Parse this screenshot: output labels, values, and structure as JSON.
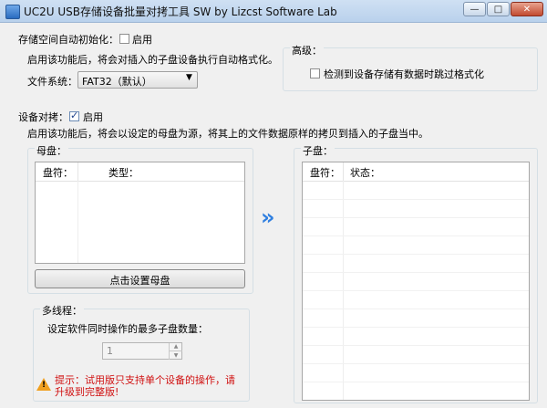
{
  "window": {
    "title": "UC2U USB存储设备批量对拷工具 SW  by Lizcst Software Lab",
    "min_label": "—",
    "max_label": "□",
    "close_label": "✕"
  },
  "autoformat": {
    "label": "存储空间自动初始化：",
    "enable_label": "启用",
    "enabled": false,
    "desc": "启用该功能后，将会对插入的子盘设备执行自动格式化。",
    "fs_label": "文件系统：",
    "fs_value": "FAT32（默认）",
    "advanced_title": "高级：",
    "skip_label": "检测到设备存储有数据时跳过格式化"
  },
  "copy": {
    "label": "设备对拷：",
    "enable_label": "启用",
    "enabled": true,
    "desc": "启用该功能后，将会以设定的母盘为源，将其上的文件数据原样的拷贝到插入的子盘当中。"
  },
  "master": {
    "title": "母盘：",
    "columns": [
      "盘符：",
      "类型："
    ],
    "set_button": "点击设置母盘"
  },
  "arrow": "»",
  "slave": {
    "title": "子盘：",
    "columns": [
      "盘符：",
      "状态："
    ]
  },
  "multithread": {
    "title": "多线程：",
    "desc": "设定软件同时操作的最多子盘数量：",
    "value": "1",
    "warning": "提示：试用版只支持单个设备的操作，请升级到完整版!"
  }
}
